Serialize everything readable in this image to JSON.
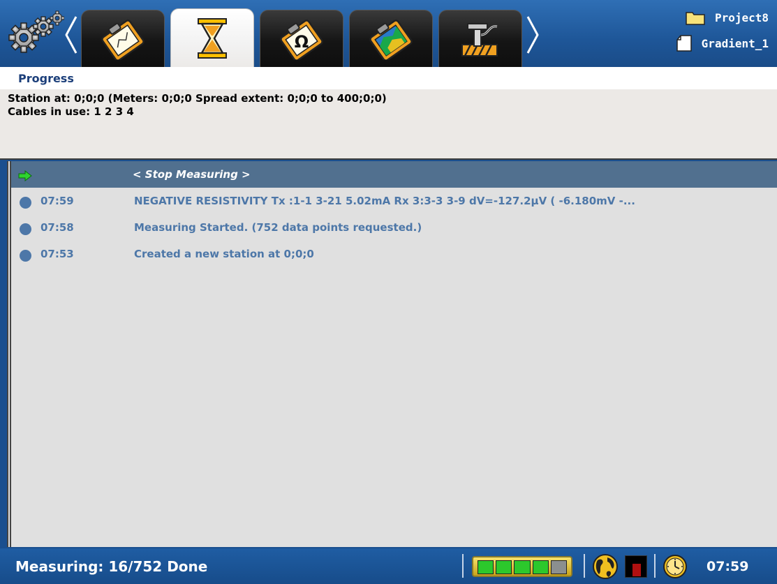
{
  "tabs": [
    {
      "name": "tab-clipboard-edit",
      "icon": "clipboard-pen-icon",
      "active": false
    },
    {
      "name": "tab-progress",
      "icon": "hourglass-icon",
      "active": true
    },
    {
      "name": "tab-clipboard-resistivity",
      "icon": "clipboard-omega-icon",
      "active": false
    },
    {
      "name": "tab-clipboard-map",
      "icon": "clipboard-map-icon",
      "active": false
    },
    {
      "name": "tab-electrode",
      "icon": "electrode-icon",
      "active": false
    }
  ],
  "project": {
    "project_name": "Project8",
    "file_name": "Gradient_1"
  },
  "progress": {
    "title": "Progress",
    "station_line": "Station at: 0;0;0 (Meters: 0;0;0 Spread extent: 0;0;0 to 400;0;0)",
    "cables_line": "Cables in use: 1 2 3 4"
  },
  "log": {
    "stop_label": "< Stop Measuring >",
    "entries": [
      {
        "time": "07:59",
        "message": "NEGATIVE RESISTIVITY Tx  :1-1 3-21 5.02mA Rx 3:3-3 3-9 dV=-127.2µV ( -6.180mV -..."
      },
      {
        "time": "07:58",
        "message": "Measuring Started. (752 data points requested.)"
      },
      {
        "time": "07:53",
        "message": "Created a new station  at 0;0;0"
      }
    ]
  },
  "status": {
    "text": "Measuring: 16/752 Done",
    "battery_level": 0.8,
    "clock_time": "07:59"
  },
  "colors": {
    "topbar": "#1e5698",
    "log_text": "#4d77a8",
    "header_row": "#51708f",
    "title_text": "#1c3f7a"
  }
}
